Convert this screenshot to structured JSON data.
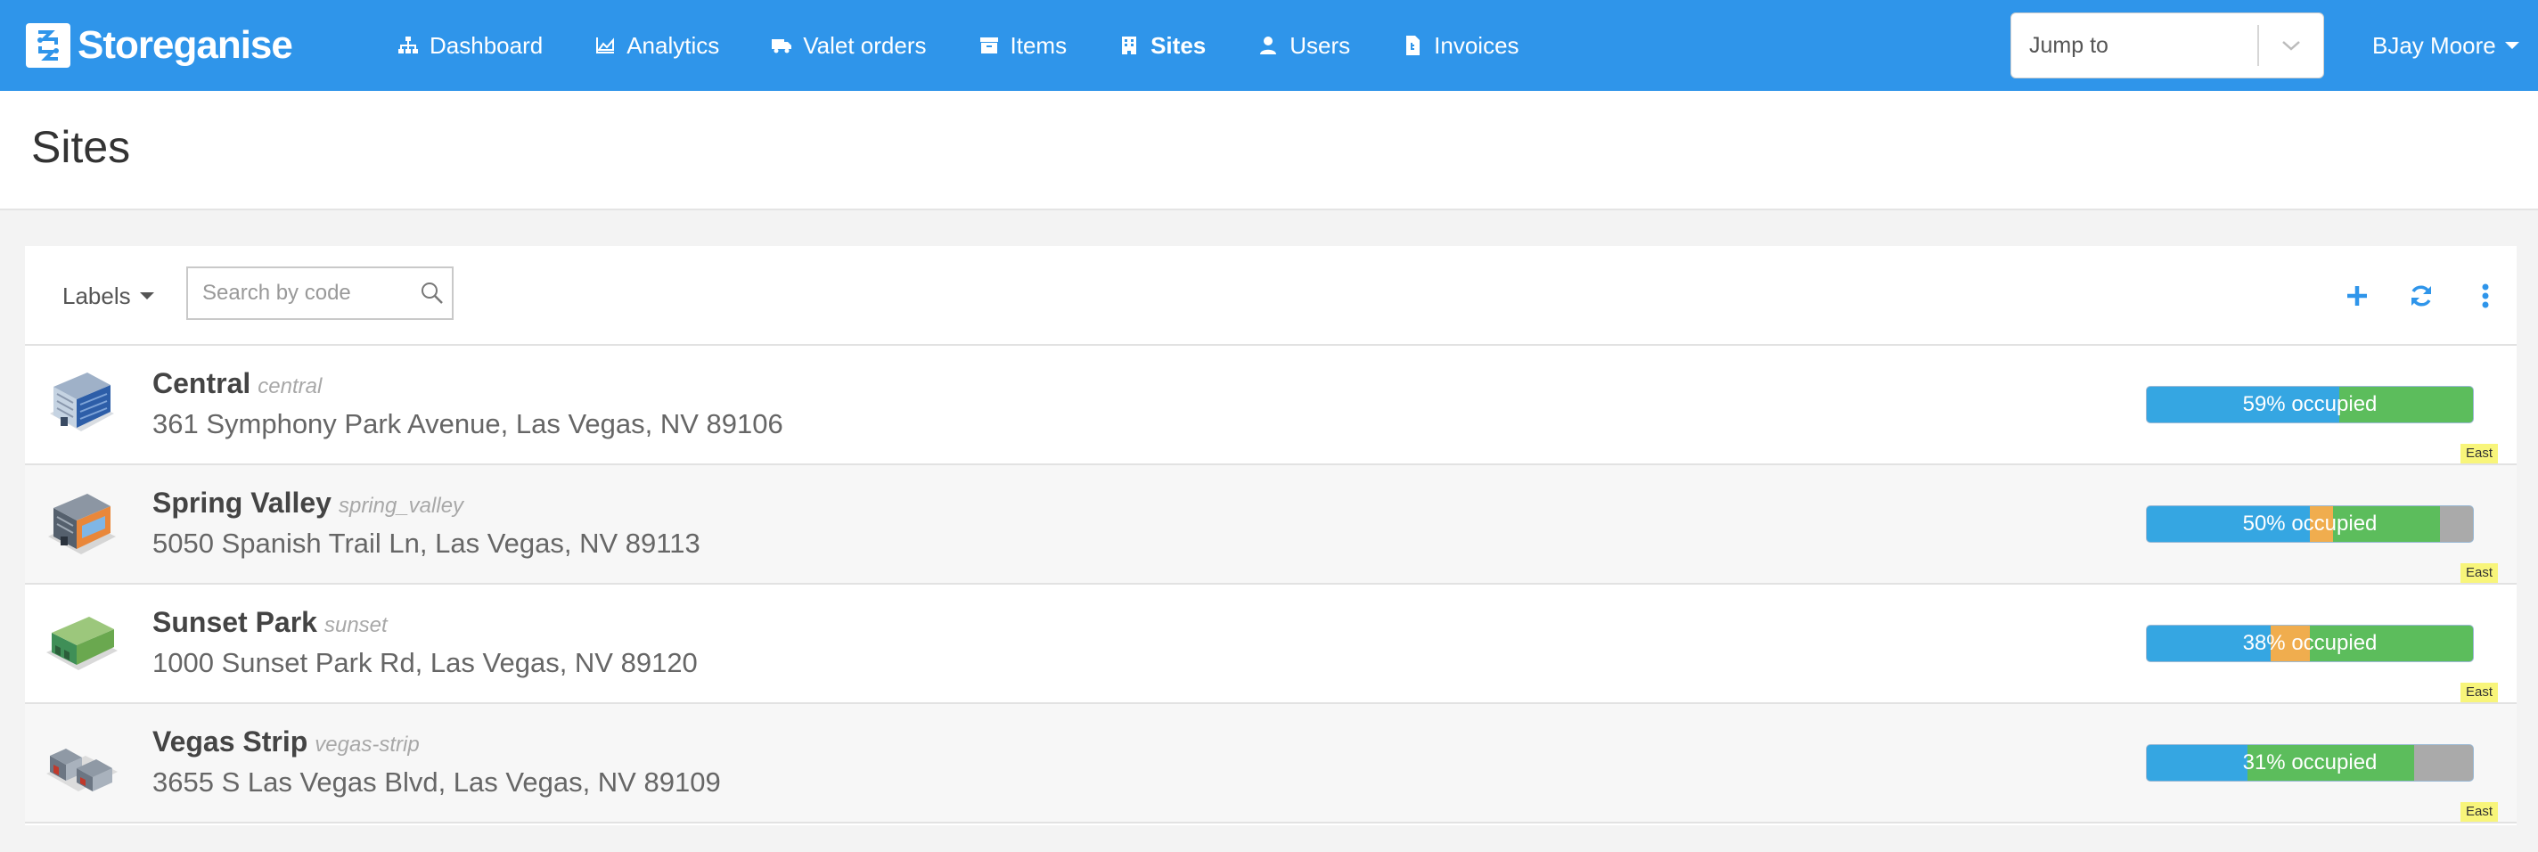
{
  "brand": {
    "name": "Storeganise"
  },
  "nav": {
    "items": [
      {
        "label": "Dashboard",
        "icon": "sitemap-icon"
      },
      {
        "label": "Analytics",
        "icon": "area-chart-icon"
      },
      {
        "label": "Valet orders",
        "icon": "truck-icon"
      },
      {
        "label": "Items",
        "icon": "archive-icon"
      },
      {
        "label": "Sites",
        "icon": "building-icon",
        "active": true
      },
      {
        "label": "Users",
        "icon": "user-icon"
      },
      {
        "label": "Invoices",
        "icon": "invoice-icon"
      }
    ],
    "jump_to": "Jump to",
    "user_name": "BJay Moore"
  },
  "page": {
    "title": "Sites"
  },
  "toolbar": {
    "labels": "Labels",
    "search_placeholder": "Search by code"
  },
  "colors": {
    "brand": "#2f95ea",
    "occupied": "#35a6e2",
    "reserved": "#f0ad4e",
    "available": "#5cbd5c",
    "unavailable": "#aaaaaa",
    "tag": "#f8f57a"
  },
  "sites": [
    {
      "name": "Central",
      "code": "central",
      "address": "361 Symphony Park Avenue, Las Vegas, NV 89106",
      "occupancy_label": "59% occupied",
      "occupied_fraction": 0.59,
      "reserved_fraction": 0.0,
      "available_fraction": 0.41,
      "unavailable_fraction": 0.0,
      "tag": "East",
      "thumb_icon": "office-building-icon"
    },
    {
      "name": "Spring Valley",
      "code": "spring_valley",
      "address": "5050 Spanish Trail Ln, Las Vegas, NV 89113",
      "occupancy_label": "50% occupied",
      "occupied_fraction": 0.5,
      "reserved_fraction": 0.07,
      "available_fraction": 0.33,
      "unavailable_fraction": 0.1,
      "tag": "East",
      "thumb_icon": "storage-building-icon"
    },
    {
      "name": "Sunset Park",
      "code": "sunset",
      "address": "1000 Sunset Park Rd, Las Vegas, NV 89120",
      "occupancy_label": "38% occupied",
      "occupied_fraction": 0.38,
      "reserved_fraction": 0.12,
      "available_fraction": 0.5,
      "unavailable_fraction": 0.0,
      "tag": "East",
      "thumb_icon": "warehouse-icon"
    },
    {
      "name": "Vegas Strip",
      "code": "vegas-strip",
      "address": "3655 S Las Vegas Blvd, Las Vegas, NV 89109",
      "occupancy_label": "31% occupied",
      "occupied_fraction": 0.31,
      "reserved_fraction": 0.0,
      "available_fraction": 0.51,
      "unavailable_fraction": 0.18,
      "tag": "East",
      "thumb_icon": "storage-units-icon"
    }
  ]
}
